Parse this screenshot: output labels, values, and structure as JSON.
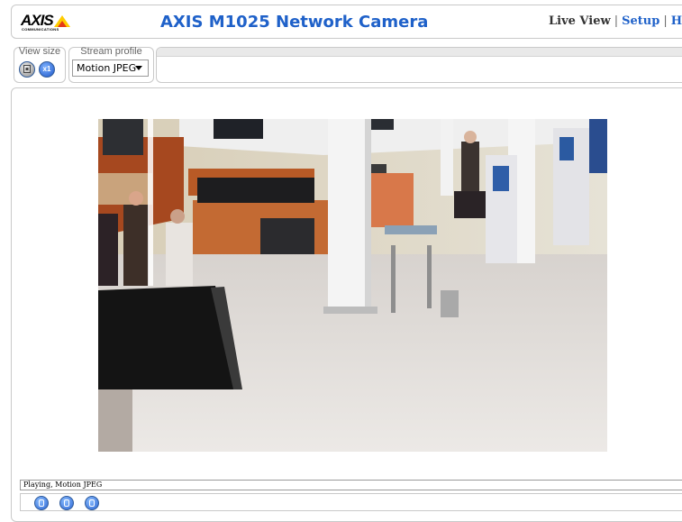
{
  "header": {
    "logo_text": "AXIS",
    "logo_subtext": "COMMUNICATIONS",
    "title": "AXIS M1025 Network Camera",
    "nav": {
      "live_view": "Live View",
      "separator": "|",
      "setup": "Setup",
      "help": "Help"
    }
  },
  "view_size": {
    "label": "View size",
    "buttons": [
      {
        "icon": "scale-icon"
      },
      {
        "icon": "x1-icon",
        "text": "x1"
      }
    ]
  },
  "stream_profile": {
    "label": "Stream profile",
    "selected": "Motion JPEG"
  },
  "video": {
    "alt": "Live camera view of an airport departure hall"
  },
  "status": {
    "text": "Playing, Motion JPEG"
  },
  "controls": [
    {
      "icon": "stop-icon"
    },
    {
      "icon": "snapshot-icon"
    },
    {
      "icon": "fullscreen-icon"
    }
  ],
  "colors": {
    "accent": "#1f61c9",
    "border": "#c9c9c9",
    "logo_yellow": "#ffcc00",
    "logo_red": "#e53a1a"
  }
}
